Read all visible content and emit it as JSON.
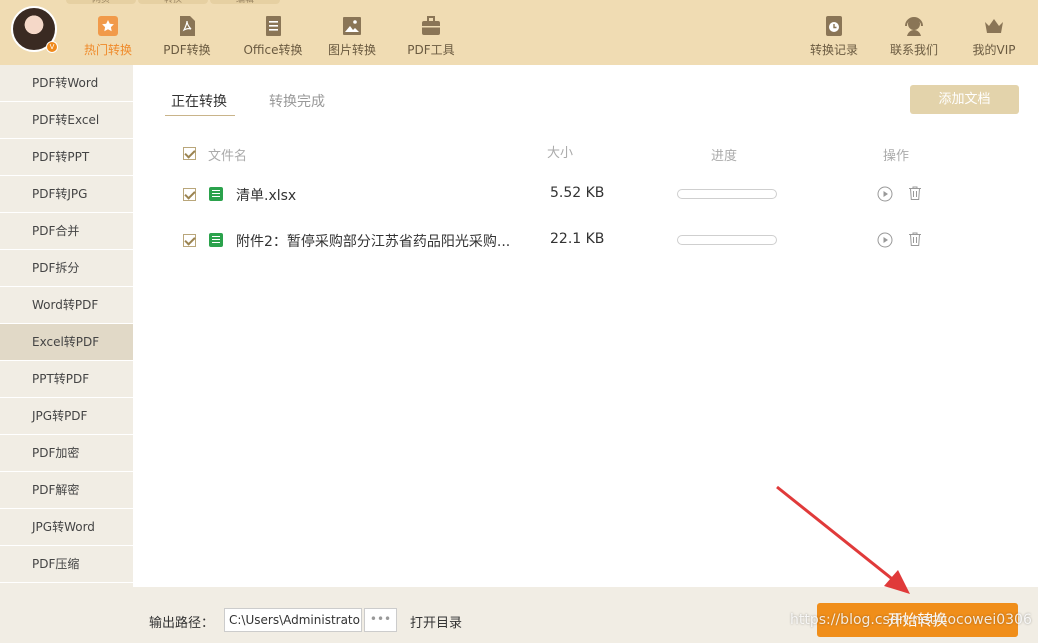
{
  "top_tabs": [
    "网页",
    "转换",
    "编辑"
  ],
  "nav_left": [
    {
      "label": "热门转换",
      "icon": "hot-star-icon",
      "active": true
    },
    {
      "label": "PDF转换",
      "icon": "pdf-file-icon",
      "active": false
    },
    {
      "label": "Office转换",
      "icon": "office-doc-icon",
      "active": false
    },
    {
      "label": "图片转换",
      "icon": "image-icon",
      "active": false
    },
    {
      "label": "PDF工具",
      "icon": "toolbox-icon",
      "active": false
    }
  ],
  "nav_right": [
    {
      "label": "转换记录",
      "icon": "history-clock-icon"
    },
    {
      "label": "联系我们",
      "icon": "headset-icon"
    },
    {
      "label": "我的VIP",
      "icon": "vip-crown-icon"
    }
  ],
  "avatar_badge": "V",
  "sidebar": [
    {
      "label": "PDF转Word"
    },
    {
      "label": "PDF转Excel"
    },
    {
      "label": "PDF转PPT"
    },
    {
      "label": "PDF转JPG"
    },
    {
      "label": "PDF合并"
    },
    {
      "label": "PDF拆分"
    },
    {
      "label": "Word转PDF"
    },
    {
      "label": "Excel转PDF"
    },
    {
      "label": "PPT转PDF"
    },
    {
      "label": "JPG转PDF"
    },
    {
      "label": "PDF加密"
    },
    {
      "label": "PDF解密"
    },
    {
      "label": "JPG转Word"
    },
    {
      "label": "PDF压缩"
    }
  ],
  "sidebar_selected": "Excel转PDF",
  "main": {
    "tab_active": "正在转换",
    "tab_done": "转换完成",
    "add_button": "添加文档",
    "columns": {
      "name": "文件名",
      "size": "大小",
      "progress": "进度",
      "action": "操作"
    },
    "rows": [
      {
        "name": "清单.xlsx",
        "size": "5.52 KB",
        "progress": 0
      },
      {
        "name": "附件2：暂停采购部分江苏省药品阳光采购...",
        "size": "22.1 KB",
        "progress": 0
      }
    ]
  },
  "bottom": {
    "output_label": "输出路径：",
    "output_path": "C:\\Users\\Administrator",
    "dots": "•••",
    "open_dir": "打开目录",
    "start_button": "开始转换"
  },
  "watermark": "https://blog.csdn.net/cocowei0306",
  "colors": {
    "accent": "#f08e1a",
    "topbar": "#f0dcb3",
    "sidebar": "#f1ede4",
    "arrow": "#e03a3a"
  }
}
